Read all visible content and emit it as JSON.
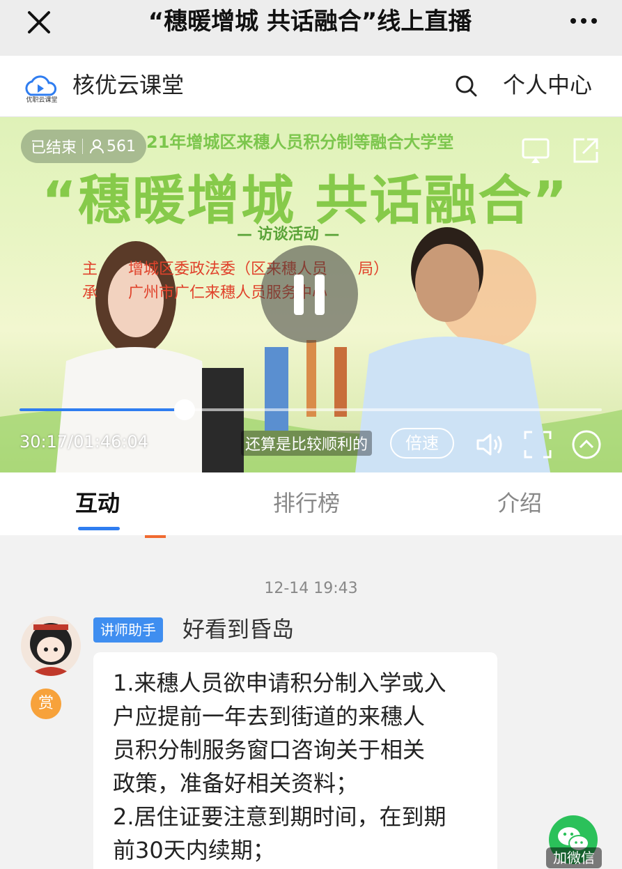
{
  "wechat_bar": {
    "title": "“穗暖增城 共话融合”线上直播"
  },
  "header": {
    "logo_text": "优职云课堂",
    "site_name": "核优云课堂",
    "personal_center": "个人中心"
  },
  "video": {
    "banner_line1": "21年增城区来穗人员积分制等融合大学堂",
    "banner_title": "“穗暖增城 共话融合”",
    "banner_subtitle": "— 访谈活动 —",
    "banner_host": "主　　增城区委政法委（区来穗人员　　局）",
    "banner_organizer": "承　　广州市广仁来穗人员服务中心",
    "status": "已结束",
    "viewers": "561",
    "progress_percent": 28.4,
    "time": "30:17/01:46:04",
    "caption": "还算是比较顺利的",
    "speed_label": "倍速"
  },
  "tabs": [
    {
      "label": "互动",
      "active": true
    },
    {
      "label": "排行榜",
      "active": false
    },
    {
      "label": "介绍",
      "active": false
    }
  ],
  "chat": {
    "timestamp": "12-14 19:43",
    "role_tag": "讲师助手",
    "sender": "好看到昏岛",
    "reward": "赏",
    "message_lines": [
      "1.来穗人员欲申请积分制入学或入",
      "户应提前一年去到街道的来穗人",
      "员积分制服务窗口咨询关于相关",
      "政策，准备好相关资料；",
      "2.居住证要注意到期时间，在到期",
      "前30天内续期；"
    ]
  },
  "wechat_button": {
    "label": "加微信"
  },
  "colors": {
    "accent": "#2f7df0",
    "tag": "#3f8ef0",
    "reward": "#f7a23b",
    "wechat": "#2bc15a"
  }
}
